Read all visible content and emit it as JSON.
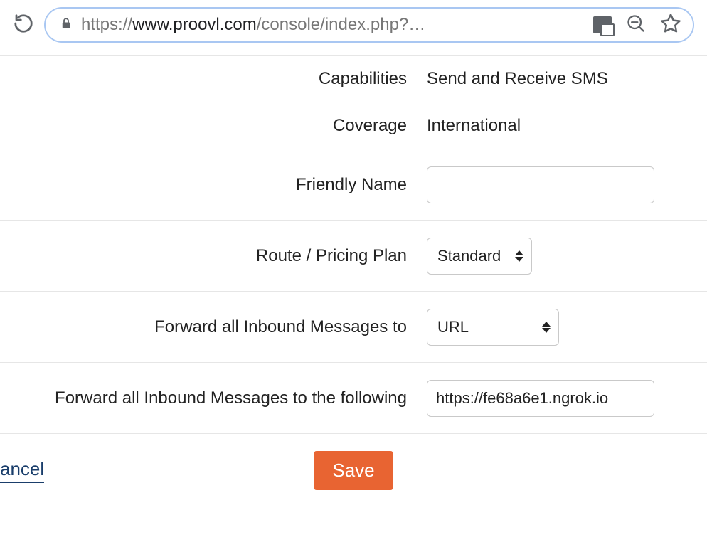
{
  "browser": {
    "url_domain": "www.proovl.com",
    "url_scheme": "https://",
    "url_path": "/console/index.php?…"
  },
  "form": {
    "capabilities": {
      "label": "Capabilities",
      "value": "Send and Receive SMS"
    },
    "coverage": {
      "label": "Coverage",
      "value": "International"
    },
    "friendly_name": {
      "label": "Friendly Name",
      "value": ""
    },
    "route": {
      "label": "Route / Pricing Plan",
      "selected": "Standard"
    },
    "forward_to": {
      "label": "Forward all Inbound Messages to",
      "selected": "URL"
    },
    "forward_url": {
      "label": "Forward all Inbound Messages to the following",
      "value": "https://fe68a6e1.ngrok.io"
    }
  },
  "actions": {
    "cancel": "ancel",
    "save": "Save"
  }
}
